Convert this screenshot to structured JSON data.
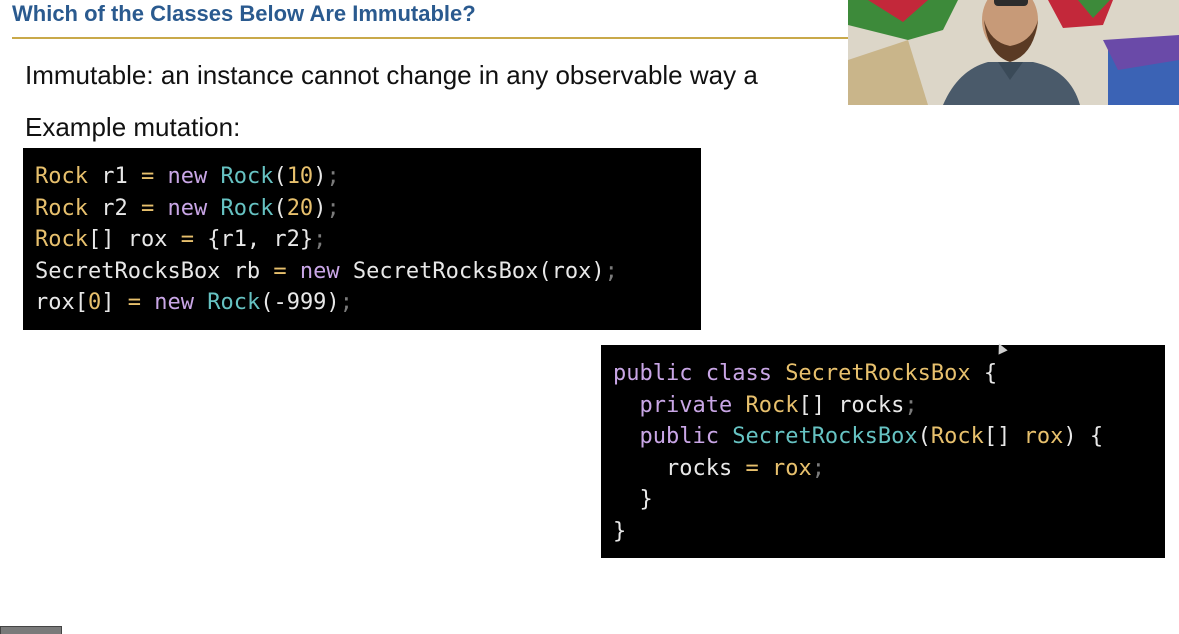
{
  "slide": {
    "title": "Which of the Classes Below Are Immutable?",
    "definition": "Immutable: an instance cannot change in any observable way a",
    "example_label": "Example mutation:"
  },
  "colors": {
    "title": "#2a5a8f",
    "rule": "#c9a94a",
    "code_bg": "#000000",
    "type": "#e7c06d",
    "keyword": "#c9a6e6",
    "constructor": "#66c2c2"
  },
  "code1": {
    "lines": [
      [
        [
          "t",
          "Rock"
        ],
        [
          "w",
          " r1 "
        ],
        [
          "op",
          "="
        ],
        [
          "k",
          " new "
        ],
        [
          "c",
          "Rock"
        ],
        [
          "w",
          "("
        ],
        [
          "n",
          "10"
        ],
        [
          "w",
          ")"
        ],
        [
          "pu",
          ";"
        ]
      ],
      [
        [
          "t",
          "Rock"
        ],
        [
          "w",
          " r2 "
        ],
        [
          "op",
          "="
        ],
        [
          "k",
          " new "
        ],
        [
          "c",
          "Rock"
        ],
        [
          "w",
          "("
        ],
        [
          "n",
          "20"
        ],
        [
          "w",
          ")"
        ],
        [
          "pu",
          ";"
        ]
      ],
      [
        [
          "t",
          "Rock"
        ],
        [
          "w",
          "[] rox "
        ],
        [
          "op",
          "="
        ],
        [
          "w",
          " {r1, r2}"
        ],
        [
          "pu",
          ";"
        ]
      ],
      [
        [
          "w",
          "SecretRocksBox rb "
        ],
        [
          "op",
          "="
        ],
        [
          "k",
          " new "
        ],
        [
          "w",
          "SecretRocksBox(rox)"
        ],
        [
          "pu",
          ";"
        ]
      ],
      [
        [
          "w",
          "rox["
        ],
        [
          "n",
          "0"
        ],
        [
          "w",
          "] "
        ],
        [
          "op",
          "="
        ],
        [
          "k",
          " new "
        ],
        [
          "c",
          "Rock"
        ],
        [
          "w",
          "(-999)"
        ],
        [
          "pu",
          ";"
        ]
      ]
    ]
  },
  "code2": {
    "lines": [
      [
        [
          "k",
          "public class "
        ],
        [
          "t",
          "SecretRocksBox"
        ],
        [
          "w",
          " {"
        ]
      ],
      [
        [
          "w",
          "  "
        ],
        [
          "k",
          "private "
        ],
        [
          "t",
          "Rock"
        ],
        [
          "w",
          "[] rocks"
        ],
        [
          "pu",
          ";"
        ]
      ],
      [
        [
          "w",
          "  "
        ],
        [
          "k",
          "public "
        ],
        [
          "c",
          "SecretRocksBox"
        ],
        [
          "w",
          "("
        ],
        [
          "t",
          "Rock"
        ],
        [
          "w",
          "[] "
        ],
        [
          "t",
          "rox"
        ],
        [
          "w",
          ") {"
        ]
      ],
      [
        [
          "w",
          "    rocks "
        ],
        [
          "op",
          "="
        ],
        [
          "w",
          " "
        ],
        [
          "t",
          "rox"
        ],
        [
          "pu",
          ";"
        ]
      ],
      [
        [
          "w",
          "  }"
        ]
      ],
      [
        [
          "w",
          "}"
        ]
      ]
    ]
  },
  "webcam": {
    "icon": "presenter-video-icon"
  },
  "cursor": {
    "icon": "mouse-pointer-icon"
  }
}
